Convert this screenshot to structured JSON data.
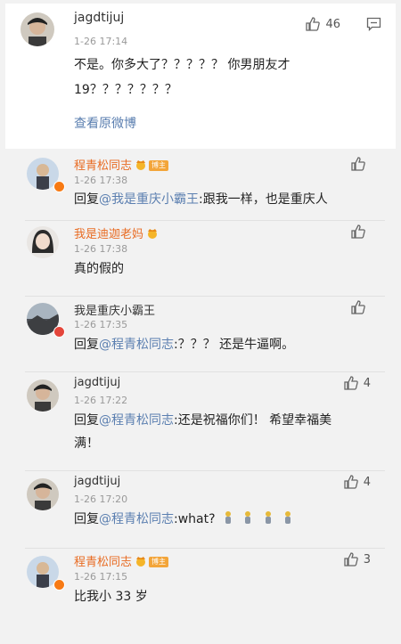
{
  "main_comment": {
    "username": "jagdtijuj",
    "time": "1-26 17:14",
    "like_count": "46",
    "text_line1": "不是。你多大了？？？？？ 你男朋友才",
    "text_line2": "19？？？？？？？",
    "view_original": "查看原微博"
  },
  "replies": [
    {
      "username": "程青松同志",
      "poster_tag": "博主",
      "time": "1-26 17:38",
      "reply_prefix": "回复",
      "mention": "@我是重庆小霸王",
      "text": ":跟我一样，也是重庆人",
      "like_count": ""
    },
    {
      "username": "我是迪迦老妈",
      "time": "1-26 17:38",
      "text": "真的假的",
      "like_count": ""
    },
    {
      "username": "我是重庆小霸王",
      "time": "1-26 17:35",
      "reply_prefix": "回复",
      "mention": "@程青松同志",
      "text": ":？？？ 还是牛逼啊。",
      "like_count": ""
    },
    {
      "username": "jagdtijuj",
      "time": "1-26 17:22",
      "reply_prefix": "回复",
      "mention": "@程青松同志",
      "text": ":还是祝福你们！ 希望幸福美",
      "text_line2": "满！",
      "like_count": "4"
    },
    {
      "username": "jagdtijuj",
      "time": "1-26 17:20",
      "reply_prefix": "回复",
      "mention": "@程青松同志",
      "text": ":what?",
      "like_count": "4"
    },
    {
      "username": "程青松同志",
      "poster_tag": "博主",
      "time": "1-26 17:15",
      "text": "比我小 33 岁",
      "like_count": "3"
    }
  ],
  "icons": {
    "like": "thumbs-up-icon",
    "comment": "comment-icon",
    "crown": "crown-emoji-icon",
    "figure": "figure-emoji-icon"
  },
  "colors": {
    "username_orange": "#e86b22",
    "mention_blue": "#5b7fb0",
    "badge_orange": "#f77a14"
  }
}
